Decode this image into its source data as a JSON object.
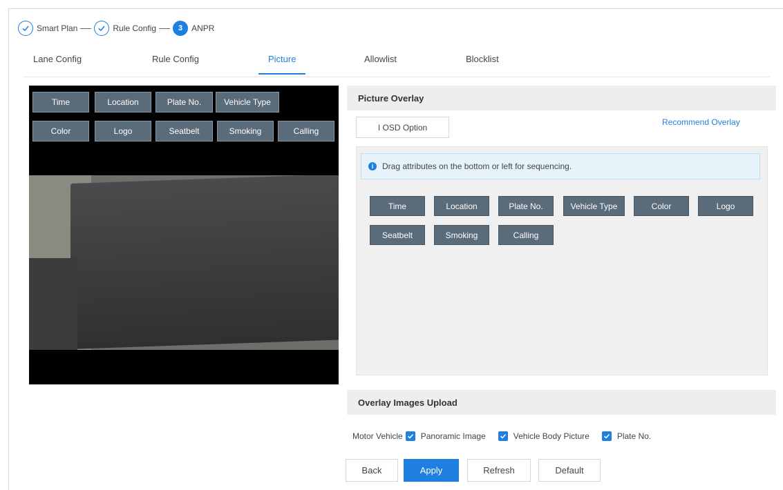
{
  "stepper": {
    "steps": [
      {
        "label": "Smart Plan",
        "state": "done"
      },
      {
        "label": "Rule Config",
        "state": "done"
      },
      {
        "label": "ANPR",
        "state": "active",
        "number": "3"
      }
    ]
  },
  "tabs": [
    "Lane Config",
    "Rule Config",
    "Picture",
    "Allowlist",
    "Blocklist"
  ],
  "active_tab": "Picture",
  "preview": {
    "tags_row1": [
      "Time",
      "Location",
      "Plate No.",
      "Vehicle Type"
    ],
    "tags_row2": [
      "Color",
      "Logo",
      "Seatbelt",
      "Smoking",
      "Calling"
    ]
  },
  "picture_overlay": {
    "title": "Picture Overlay",
    "osd_option": "I OSD Option",
    "recommend_link": "Recommend Overlay",
    "tip": "Drag attributes on the bottom or left for sequencing.",
    "chips_row1": [
      "Time",
      "Location",
      "Plate No.",
      "Vehicle Type",
      "Color",
      "Logo"
    ],
    "chips_row2": [
      "Seatbelt",
      "Smoking",
      "Calling"
    ]
  },
  "overlay_upload": {
    "title": "Overlay Images Upload",
    "prefix": "Motor Vehicle",
    "options": [
      {
        "label": "Panoramic Image",
        "checked": true
      },
      {
        "label": "Vehicle Body Picture",
        "checked": true
      },
      {
        "label": "Plate No.",
        "checked": true
      }
    ]
  },
  "buttons": {
    "back": "Back",
    "apply": "Apply",
    "refresh": "Refresh",
    "default": "Default"
  },
  "colors": {
    "accent": "#1f7fe0",
    "tag": "#5a6b7a"
  }
}
